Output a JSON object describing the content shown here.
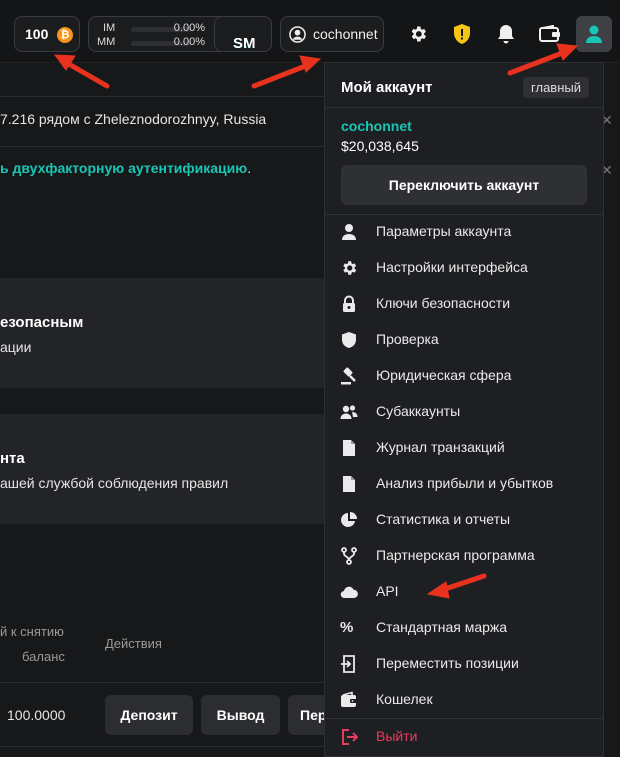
{
  "topbar": {
    "btc_balance": "100",
    "btc_symbol": "₿",
    "im_label": "IM",
    "mm_label": "MM",
    "im_value": "0.00%",
    "mm_value": "0.00%",
    "sm_prefix": "S:",
    "sm_value": "SM",
    "username": "cochonnet"
  },
  "background": {
    "location_text": "7.216 рядом с Zheleznodorozhnyy, Russia",
    "twofa_text": "ь двухфакторную аутентификацию",
    "twofa_suffix": ".",
    "card1_title": "езопасным",
    "card1_sub": "ации",
    "card2_title": "нта",
    "card2_sub": "ашей службой соблюдения правил",
    "col_withdraw_1": "й к снятию",
    "col_withdraw_2": "баланс",
    "col_actions": "Действия",
    "row_value": "100.0000",
    "deposit_label": "Депозит",
    "withdraw_label": "Вывод",
    "transfer_label": "Пер"
  },
  "menu": {
    "title": "Мой аккаунт",
    "badge": "главный",
    "account_name": "cochonnet",
    "account_balance": "$20,038,645",
    "switch_label": "Переключить аккаунт",
    "items": [
      {
        "label": "Параметры аккаунта",
        "icon": "user-icon"
      },
      {
        "label": "Настройки интерфейса",
        "icon": "gear-icon"
      },
      {
        "label": "Ключи безопасности",
        "icon": "lock-icon"
      },
      {
        "label": "Проверка",
        "icon": "shield-icon"
      },
      {
        "label": "Юридическая сфера",
        "icon": "gavel-icon"
      },
      {
        "label": "Субаккаунты",
        "icon": "users-icon"
      },
      {
        "label": "Журнал транзакций",
        "icon": "file-icon"
      },
      {
        "label": "Анализ прибыли и убытков",
        "icon": "file-icon"
      },
      {
        "label": "Статистика и отчеты",
        "icon": "pie-chart-icon"
      },
      {
        "label": "Партнерская программа",
        "icon": "fork-icon"
      },
      {
        "label": "API",
        "icon": "cloud-icon"
      },
      {
        "label": "Стандартная маржа",
        "icon": "percent-icon"
      },
      {
        "label": "Переместить позиции",
        "icon": "move-icon"
      },
      {
        "label": "Кошелек",
        "icon": "wallet-icon"
      }
    ],
    "logout_label": "Выйти"
  },
  "colors": {
    "accent_teal": "#19c6b5",
    "logout_red": "#e83a5f",
    "annotation_arrow": "#e8321e",
    "bitcoin_orange": "#f7931a",
    "shield_yellow": "#f5c518"
  }
}
